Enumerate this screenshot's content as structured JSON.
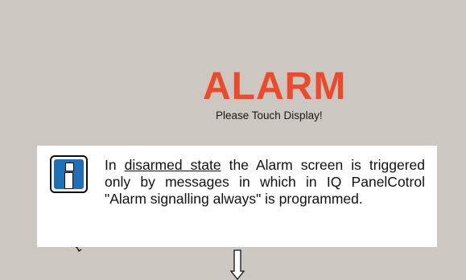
{
  "screen": {
    "alarm_title": "ALARM",
    "touch_prompt": "Please Touch Display!"
  },
  "note": {
    "icon": "info-icon",
    "text_prefix": "In ",
    "text_underlined": "disarmed state",
    "text_suffix": " the Alarm screen is triggered only by messages in which in IQ PanelCotrol \"Alarm signalling always\" is programmed."
  },
  "colors": {
    "alarm_red": "#ec4a2a",
    "screen_background": "#ccc7c0",
    "info_blue": "#1f6eb8"
  }
}
